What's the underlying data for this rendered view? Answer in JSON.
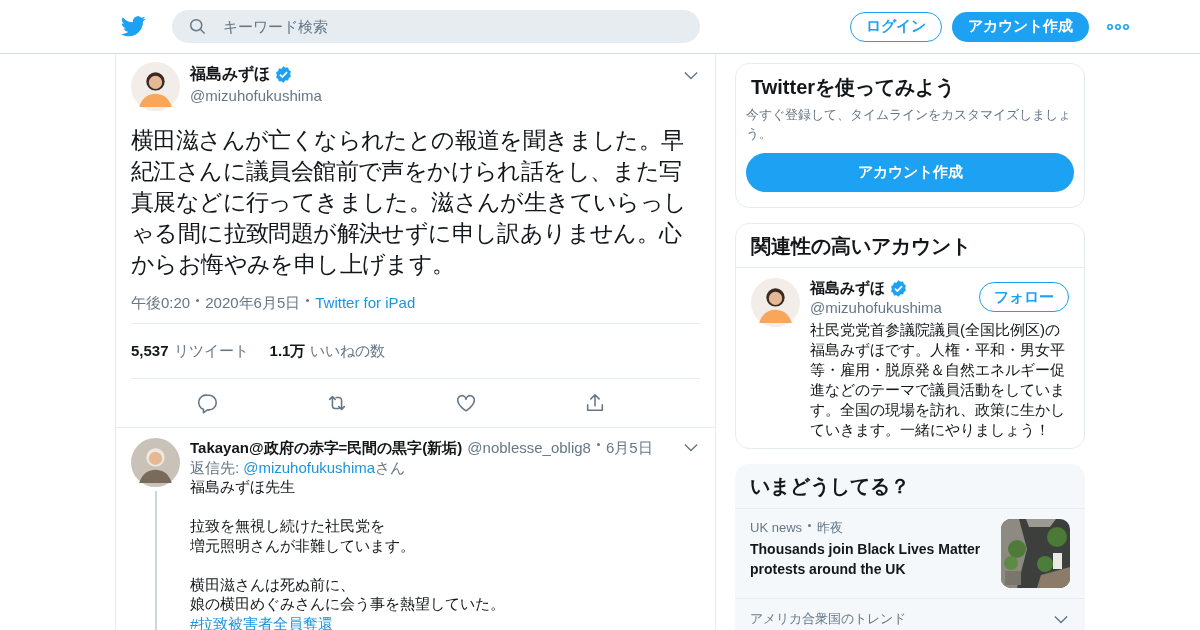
{
  "header": {
    "search_placeholder": "キーワード検索",
    "login": "ログイン",
    "signup": "アカウント作成"
  },
  "tweet": {
    "name": "福島みずほ",
    "verified": true,
    "handle": "@mizuhofukushima",
    "text": "横田滋さんが亡くなられたとの報道を聞きました。早紀江さんに議員会館前で声をかけられ話をし、また写真展などに行ってきました。滋さんが生きていらっしゃる間に拉致問題が解決せずに申し訳ありません。心からお悔やみを申し上げます。",
    "time": "午後0:20",
    "date": "2020年6月5日",
    "source": "Twitter for iPad",
    "retweets": {
      "count": "5,537",
      "label": "リツイート"
    },
    "likes": {
      "count": "1.1万",
      "label": "いいねの数"
    }
  },
  "reply": {
    "name": "Takayan@政府の赤字=民間の黒字(新垢)",
    "handle": "@noblesse_oblig8",
    "date": "6月5日",
    "reply_to_label": "返信先:",
    "reply_to": "@mizuhofukushima",
    "reply_to_suffix": "さん",
    "paragraphs": [
      [
        "福島みずほ先生"
      ],
      [
        "拉致を無視し続けた社民党を",
        "増元照明さんが非難しています。"
      ],
      [
        "横田滋さんは死ぬ前に、",
        "娘の横田めぐみさんに会う事を熱望していた。"
      ]
    ],
    "hashtag": "#拉致被害者全員奪還"
  },
  "sidebar": {
    "signup_card": {
      "title": "Twitterを使ってみよう",
      "text": "今すぐ登録して、タイムラインをカスタマイズしましょう。",
      "button": "アカウント作成"
    },
    "related": {
      "title": "関連性の高いアカウント",
      "accounts": [
        {
          "name": "福島みずほ",
          "verified": true,
          "handle": "@mizuhofukushima",
          "follow": "フォロー",
          "bio": "社民党党首参議院議員(全国比例区)の福島みずほです。人権・平和・男女平等・雇用・脱原発＆自然エネルギー促進などのテーマで議員活動をしています。全国の現場を訪れ、政策に生かしていきます。一緒にやりましょう！"
        }
      ]
    },
    "trends": {
      "title": "いまどうしてる？",
      "items": [
        {
          "kind": "news",
          "category": "UK news",
          "time": "昨夜",
          "headline": "Thousands join Black Lives Matter protests around the UK"
        },
        {
          "kind": "heading",
          "label": "アメリカ合衆国のトレンド"
        }
      ]
    }
  }
}
